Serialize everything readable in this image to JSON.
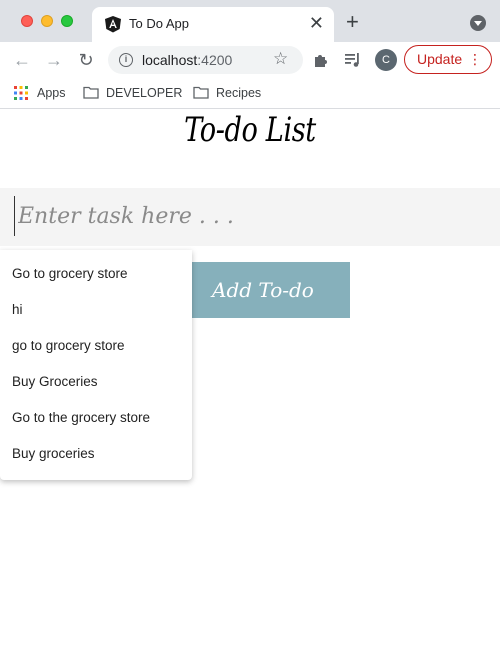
{
  "browser": {
    "tab_title": "To Do App",
    "url_host": "localhost",
    "url_port": ":4200",
    "avatar_initial": "C",
    "update_label": "Update"
  },
  "bookmarks": [
    {
      "label": "Apps",
      "icon": "apps-grid-icon"
    },
    {
      "label": "DEVELOPER",
      "icon": "folder-icon"
    },
    {
      "label": "Recipes",
      "icon": "folder-icon"
    }
  ],
  "page": {
    "title": "To-do List",
    "input_placeholder": "Enter task here . . .",
    "add_button_label": "Add To-do",
    "suggestions": [
      "Go to grocery store",
      "hi",
      "go to grocery store",
      "Buy Groceries",
      "Go to the grocery store",
      "Buy groceries"
    ]
  },
  "colors": {
    "add_button": "#86b0bb",
    "input_background": "#f4f4f4",
    "update_accent": "#c5221f"
  }
}
